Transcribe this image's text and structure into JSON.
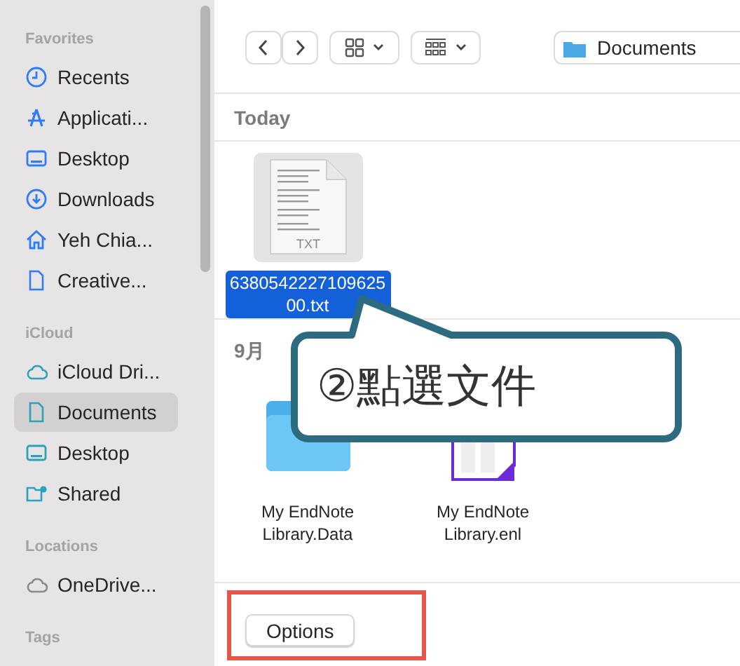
{
  "sidebar": {
    "sections": [
      {
        "title": "Favorites",
        "items": [
          {
            "label": "Recents",
            "kind": "clock",
            "selected": false
          },
          {
            "label": "Applicati...",
            "kind": "apps",
            "selected": false
          },
          {
            "label": "Desktop",
            "kind": "desktop",
            "selected": false
          },
          {
            "label": "Downloads",
            "kind": "download",
            "selected": false
          },
          {
            "label": "Yeh Chia...",
            "kind": "home",
            "selected": false
          },
          {
            "label": "Creative...",
            "kind": "doc",
            "selected": false
          }
        ]
      },
      {
        "title": "iCloud",
        "items": [
          {
            "label": "iCloud Dri...",
            "kind": "cloud",
            "selected": false
          },
          {
            "label": "Documents",
            "kind": "doc",
            "selected": true
          },
          {
            "label": "Desktop",
            "kind": "desktop",
            "selected": false
          },
          {
            "label": "Shared",
            "kind": "shared",
            "selected": false
          }
        ]
      },
      {
        "title": "Locations",
        "items": [
          {
            "label": "OneDrive...",
            "kind": "cloud",
            "selected": false
          }
        ]
      },
      {
        "title": "Tags"
      }
    ]
  },
  "toolbar": {
    "location": "Documents"
  },
  "groups": [
    {
      "title": "Today",
      "files": [
        {
          "name": "638054222710962500.txt",
          "kind": "txt",
          "label": "TXT",
          "selected": true
        }
      ]
    },
    {
      "title": "9月",
      "files": [
        {
          "name": "My EndNote Library.Data",
          "kind": "folder",
          "selected": false
        },
        {
          "name": "My EndNote Library.enl",
          "kind": "endnote",
          "selected": false
        }
      ]
    }
  ],
  "callout": {
    "text": "②點選文件"
  },
  "footer": {
    "button": "Options",
    "highlighted": true
  }
}
